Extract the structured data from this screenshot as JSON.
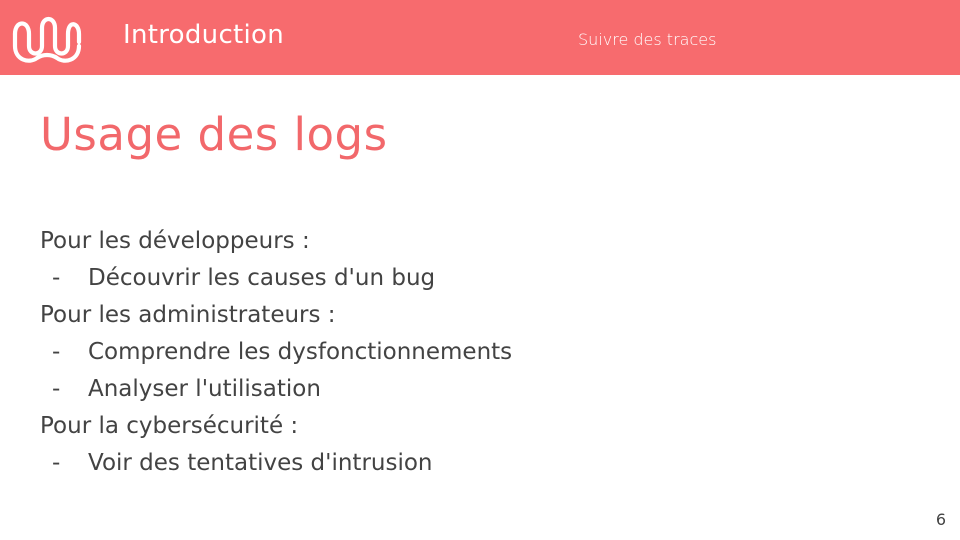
{
  "header": {
    "section_title": "Introduction",
    "subtitle": "Suivre des traces",
    "logo_icon": "wave-loops-logo-icon",
    "background_color": "#f76b6e"
  },
  "slide": {
    "title": "Usage des logs",
    "title_color": "#f2686b",
    "content": [
      {
        "type": "heading",
        "text": "Pour les développeurs :"
      },
      {
        "type": "bullet",
        "marker": "-",
        "text": "Découvrir les causes d'un bug"
      },
      {
        "type": "heading",
        "text": "Pour les administrateurs :"
      },
      {
        "type": "bullet",
        "marker": "-",
        "text": "Comprendre les dysfonctionnements"
      },
      {
        "type": "bullet",
        "marker": "-",
        "text": "Analyser l'utilisation"
      },
      {
        "type": "heading",
        "text": "Pour la cybersécurité :"
      },
      {
        "type": "bullet",
        "marker": "-",
        "text": "Voir des tentatives d'intrusion"
      }
    ],
    "page_number": "6"
  }
}
